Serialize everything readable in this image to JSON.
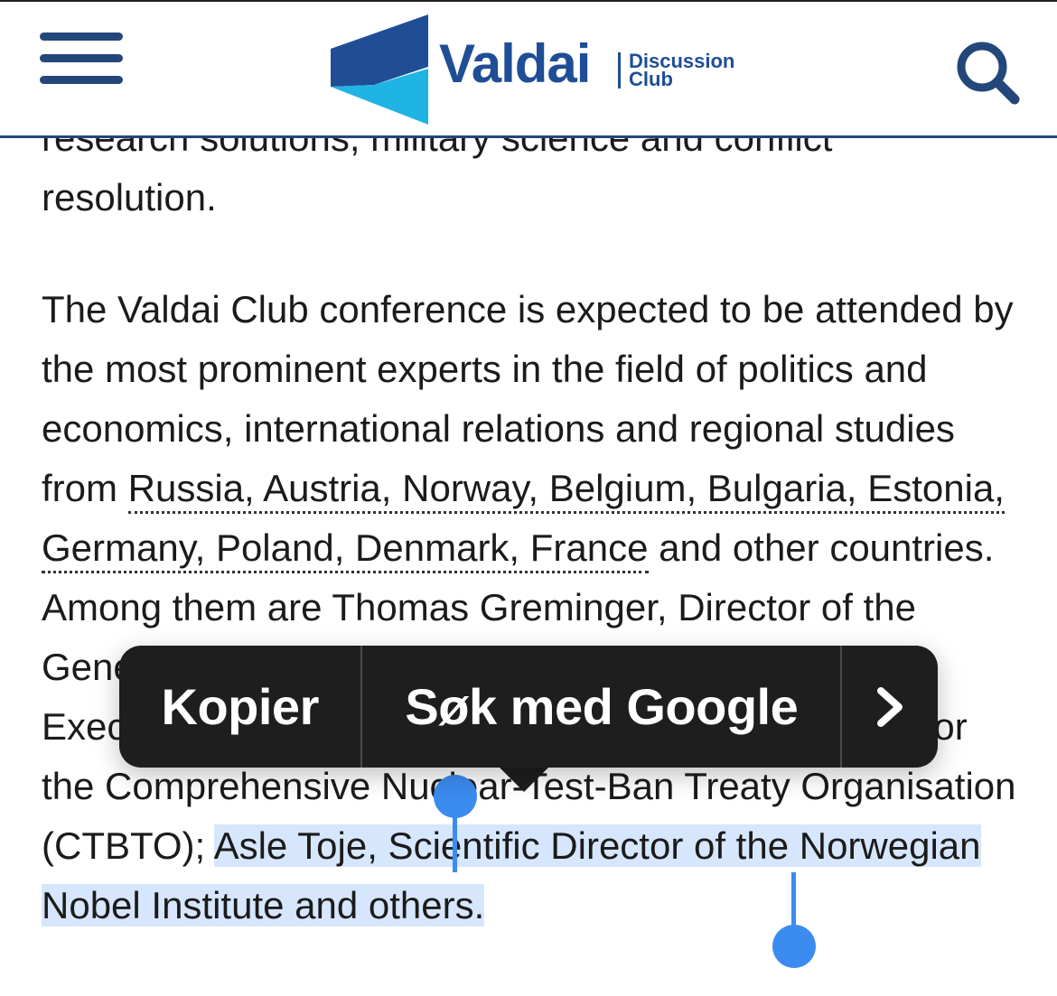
{
  "header": {
    "logo_word": "Valdai",
    "logo_sub_1": "Discussion",
    "logo_sub_2": "Club",
    "brand_dark": "#1f4e96",
    "brand_light": "#1fb4e4",
    "menu_icon": "hamburger-icon",
    "search_icon": "search-icon"
  },
  "article": {
    "p1_partial": "research solutions, military science and conflict",
    "p1_end": "resolution.",
    "p2_start": "The Valdai Club conference is expected to be attended by the most prominent experts in the field of politics and economics, international relations and regional studies from ",
    "countries_link": "Russia, Austria, Norway, Belgium, Bulgaria, Estonia, Germany, Poland, Denmark, France",
    "p2_mid": " and other countries. Among them are Thomas Greminger, Director of the Geneva Centre for Security Policy; Robert Floyd, Executive Secretary of the Preparatory Commission for the Comprehensive Nuclear-Test-Ban Treaty Organisation (CTBTO); ",
    "p2_selected": "Asle Toje, Scientific Director of the Norwegian Nobel Institute and others."
  },
  "popup": {
    "copy_label": "Kopier",
    "search_label": "Søk med Google",
    "more_label": "›"
  },
  "colors": {
    "selection": "#5296f2",
    "handle": "#3c8bf0",
    "popup_bg": "#1e1e1e"
  }
}
